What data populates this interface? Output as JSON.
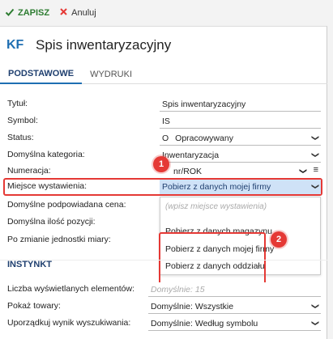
{
  "toolbar": {
    "save_label": "ZAPISZ",
    "cancel_label": "Anuluj"
  },
  "header": {
    "icon_text": "KF",
    "title": "Spis inwentaryzacyjny"
  },
  "tabs": [
    {
      "label": "PODSTAWOWE",
      "active": true
    },
    {
      "label": "WYDRUKI",
      "active": false
    }
  ],
  "form": {
    "title_label": "Tytuł:",
    "title_value": "Spis inwentaryzacyjny",
    "symbol_label": "Symbol:",
    "symbol_value": "IS",
    "status_label": "Status:",
    "status_prefix": "O",
    "status_value": "Opracowywany",
    "category_label": "Domyślna kategoria:",
    "category_value": "Inwentaryzacja",
    "numbering_label": "Numeracja:",
    "numbering_value": "nr/ROK",
    "place_label": "Miejsce wystawienia:",
    "place_value": "Pobierz z danych mojej firmy",
    "price_label": "Domyślne podpowiadana cena:",
    "qty_label": "Domyślna ilość pozycji:",
    "unit_label": "Po zmianie jednostki miary:"
  },
  "dropdown": {
    "placeholder": "(wpisz miejsce wystawienia)",
    "options": [
      "Pobierz z danych magazynu",
      "Pobierz z danych mojej firmy",
      "Pobierz z danych oddziału"
    ]
  },
  "instynkt": {
    "section_title": "INSTYNKT",
    "count_label": "Liczba wyświetlanych elementów:",
    "count_placeholder": "Domyślnie: 15",
    "show_label": "Pokaż towary:",
    "show_value": "Domyślnie: Wszystkie",
    "sort_label": "Uporządkuj wynik wyszukiwania:",
    "sort_value": "Domyślnie: Według symbolu"
  },
  "badges": {
    "one": "1",
    "two": "2"
  },
  "colors": {
    "accent": "#1f6fb2",
    "save_green": "#2e7d32",
    "highlight_red": "#e53935",
    "selection": "#cfe2f7"
  }
}
